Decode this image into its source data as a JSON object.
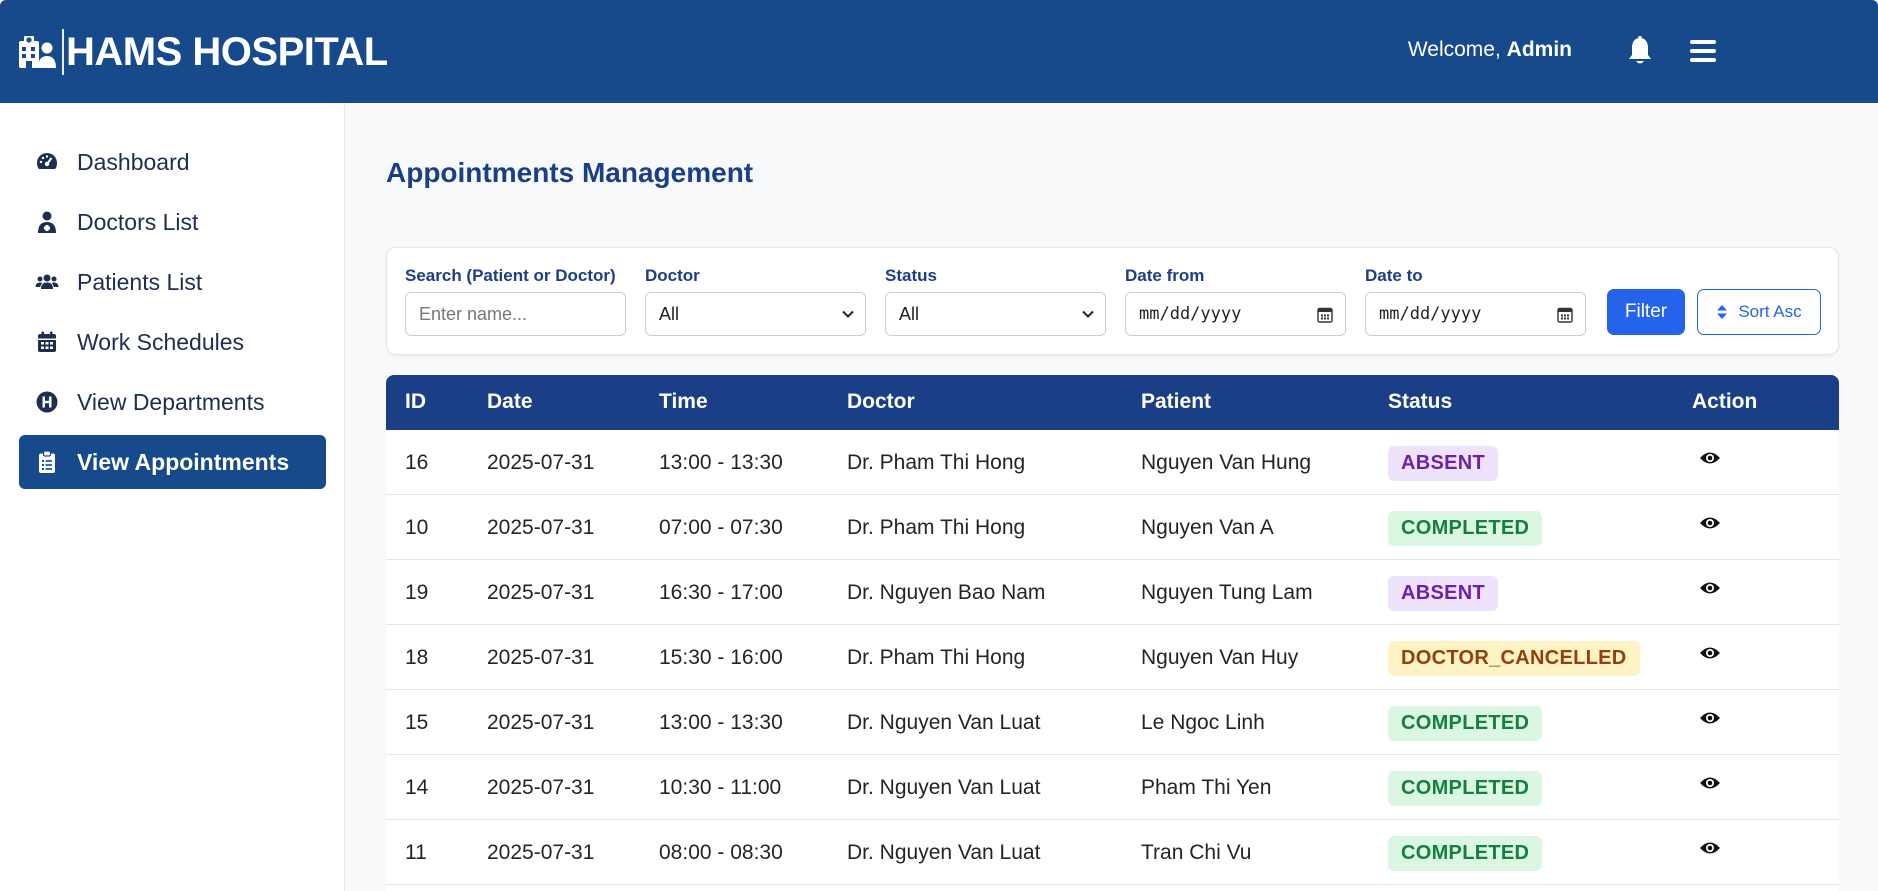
{
  "header": {
    "title": "HAMS HOSPITAL",
    "welcome_prefix": "Welcome,",
    "user": "Admin"
  },
  "sidebar": {
    "items": [
      {
        "label": "Dashboard",
        "icon": "gauge-icon"
      },
      {
        "label": "Doctors List",
        "icon": "user-doctor-icon"
      },
      {
        "label": "Patients List",
        "icon": "users-icon"
      },
      {
        "label": "Work Schedules",
        "icon": "calendar-icon"
      },
      {
        "label": "View Departments",
        "icon": "hospital-h-icon"
      },
      {
        "label": "View Appointments",
        "icon": "clipboard-icon",
        "active": true
      }
    ]
  },
  "main": {
    "title": "Appointments Management"
  },
  "filters": {
    "search_label": "Search (Patient or Doctor)",
    "search_placeholder": "Enter name...",
    "doctor_label": "Doctor",
    "doctor_value": "All",
    "status_label": "Status",
    "status_value": "All",
    "date_from_label": "Date from",
    "date_from_value": "mm/dd/yyyy",
    "date_to_label": "Date to",
    "date_to_value": "mm/dd/yyyy",
    "filter_button": "Filter",
    "sort_button": "Sort Asc"
  },
  "table": {
    "headers": [
      "ID",
      "Date",
      "Time",
      "Doctor",
      "Patient",
      "Status",
      "Action"
    ],
    "rows": [
      {
        "id": "16",
        "date": "2025-07-31",
        "time": "13:00 - 13:30",
        "doctor": "Dr. Pham Thi Hong",
        "patient": "Nguyen Van Hung",
        "status": "ABSENT"
      },
      {
        "id": "10",
        "date": "2025-07-31",
        "time": "07:00 - 07:30",
        "doctor": "Dr. Pham Thi Hong",
        "patient": "Nguyen Van A",
        "status": "COMPLETED"
      },
      {
        "id": "19",
        "date": "2025-07-31",
        "time": "16:30 - 17:00",
        "doctor": "Dr. Nguyen Bao Nam",
        "patient": "Nguyen Tung Lam",
        "status": "ABSENT"
      },
      {
        "id": "18",
        "date": "2025-07-31",
        "time": "15:30 - 16:00",
        "doctor": "Dr. Pham Thi Hong",
        "patient": "Nguyen Van Huy",
        "status": "DOCTOR_CANCELLED"
      },
      {
        "id": "15",
        "date": "2025-07-31",
        "time": "13:00 - 13:30",
        "doctor": "Dr. Nguyen Van Luat",
        "patient": "Le Ngoc Linh",
        "status": "COMPLETED"
      },
      {
        "id": "14",
        "date": "2025-07-31",
        "time": "10:30 - 11:00",
        "doctor": "Dr. Nguyen Van Luat",
        "patient": "Pham Thi Yen",
        "status": "COMPLETED"
      },
      {
        "id": "11",
        "date": "2025-07-31",
        "time": "08:00 - 08:30",
        "doctor": "Dr. Nguyen Van Luat",
        "patient": "Tran Chi Vu",
        "status": "COMPLETED"
      }
    ]
  },
  "colors": {
    "header_bg": "#164a8a",
    "table_header_bg": "#1b3f86",
    "accent": "#2563eb",
    "absent": "#6b21a8",
    "completed": "#15803d",
    "cancelled": "#92400e"
  }
}
